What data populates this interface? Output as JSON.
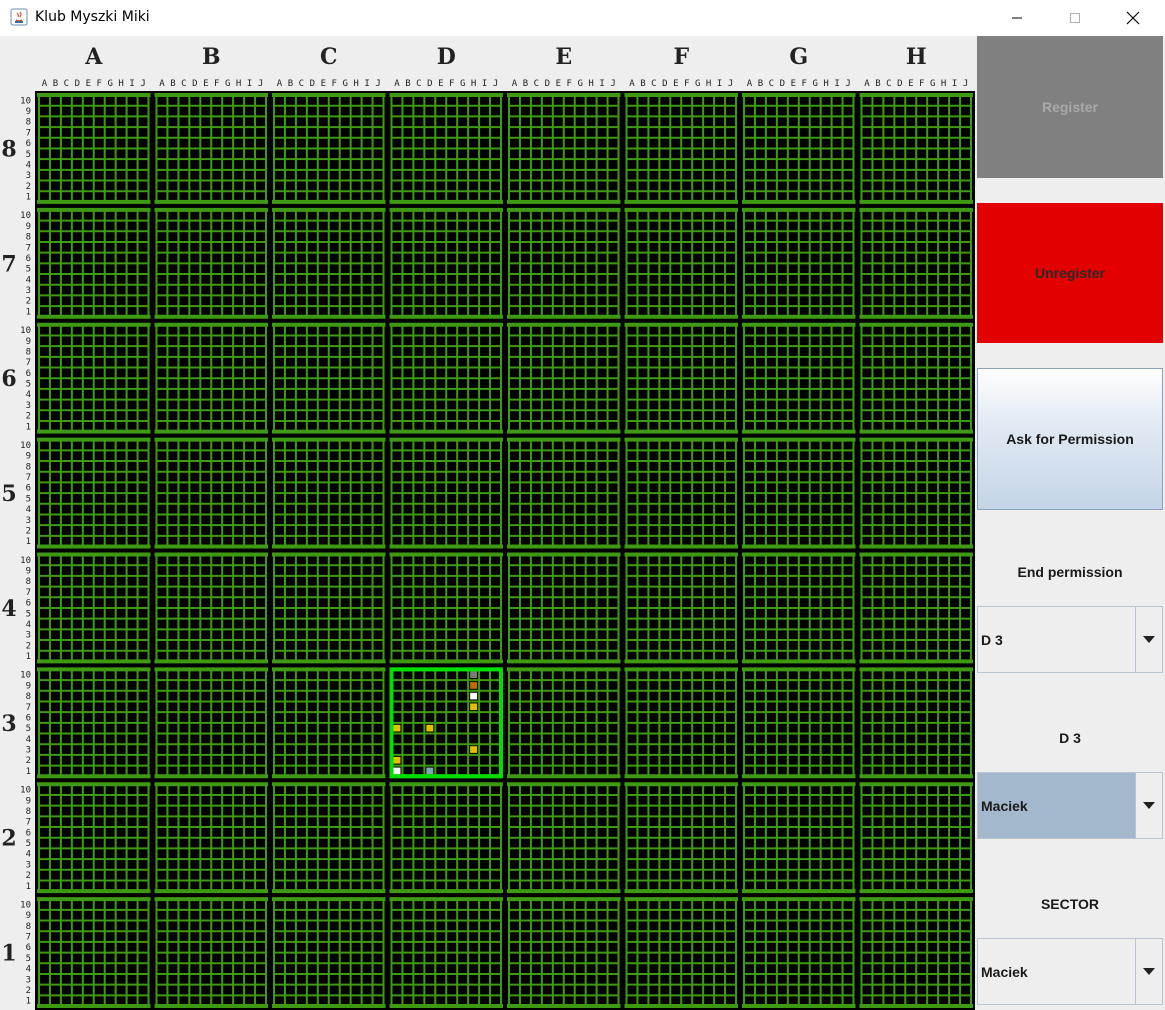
{
  "window": {
    "title": "Klub Myszki Miki",
    "icons": [
      "java-icon",
      "minimize-icon",
      "maximize-icon",
      "close-icon"
    ]
  },
  "board": {
    "columns": [
      "A",
      "B",
      "C",
      "D",
      "E",
      "F",
      "G",
      "H"
    ],
    "rows": [
      "8",
      "7",
      "6",
      "5",
      "4",
      "3",
      "2",
      "1"
    ],
    "sub_columns": [
      "A",
      "B",
      "C",
      "D",
      "E",
      "F",
      "G",
      "H",
      "I",
      "J"
    ],
    "sub_rows": [
      "10",
      "9",
      "8",
      "7",
      "6",
      "5",
      "4",
      "3",
      "2",
      "1"
    ],
    "selected_sector": {
      "column": "D",
      "row": "3"
    },
    "marked_cells": [
      {
        "sub_col": "H",
        "sub_row": "10",
        "color": "#7a7a7a"
      },
      {
        "sub_col": "H",
        "sub_row": "9",
        "color": "#c46a00"
      },
      {
        "sub_col": "H",
        "sub_row": "8",
        "color": "#ffffff"
      },
      {
        "sub_col": "H",
        "sub_row": "7",
        "color": "#e6c000"
      },
      {
        "sub_col": "A",
        "sub_row": "5",
        "color": "#e6c000"
      },
      {
        "sub_col": "D",
        "sub_row": "5",
        "color": "#e6c000"
      },
      {
        "sub_col": "H",
        "sub_row": "3",
        "color": "#e6c000"
      },
      {
        "sub_col": "A",
        "sub_row": "2",
        "color": "#e6c000"
      },
      {
        "sub_col": "A",
        "sub_row": "1",
        "color": "#ffffff"
      },
      {
        "sub_col": "D",
        "sub_row": "1",
        "color": "#80a8b0"
      }
    ],
    "colors": {
      "background": "#000000",
      "grid": "#3f9a13",
      "selection_border": "#00e000",
      "header_background": "#eeeeee"
    }
  },
  "sidebar": {
    "register_label": "Register",
    "unregister_label": "Unregister",
    "ask_permission_label": "Ask for Permission",
    "end_permission_label": "End permission",
    "sector_combo_value": "D 3",
    "sector_display": "D 3",
    "user_combo_value": "Maciek",
    "sector_caption": "SECTOR",
    "sector_owner_value": "Maciek",
    "colors": {
      "register": "#808080",
      "unregister": "#e20000"
    }
  }
}
